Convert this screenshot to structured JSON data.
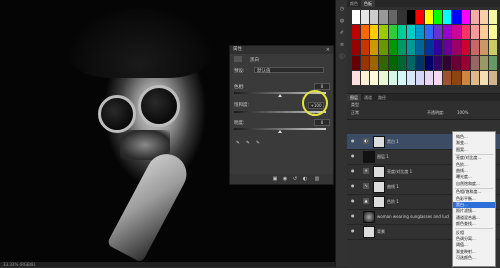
{
  "status": {
    "text": "33.33% (RGB/8)"
  },
  "properties": {
    "title": "属性",
    "adjustment_name": "黑白",
    "preset_label": "预设:",
    "preset_value": "默认值",
    "slider1_label": "色相:",
    "slider1_value": "0",
    "slider2_label": "饱和度:",
    "slider2_value": "+100",
    "slider3_label": "明度:",
    "slider3_value": "0"
  },
  "swatches": {
    "tabs": [
      "颜色",
      "色板"
    ],
    "colors": [
      "#ffffff",
      "#e6e6e6",
      "#cccccc",
      "#999999",
      "#666666",
      "#333333",
      "#000000",
      "#ff0000",
      "#ffff00",
      "#00ff00",
      "#00ffff",
      "#0000ff",
      "#ff00ff",
      "#f5a9a9",
      "#f5d0a9",
      "#f5f5a9",
      "#c00000",
      "#ff6600",
      "#ffcc00",
      "#99cc00",
      "#33cc33",
      "#00cc99",
      "#00cccc",
      "#0099cc",
      "#3366ff",
      "#6633cc",
      "#9900cc",
      "#cc0099",
      "#ff3366",
      "#ff9999",
      "#ffcc99",
      "#ffff99",
      "#990000",
      "#cc3300",
      "#cc9900",
      "#669900",
      "#009900",
      "#009966",
      "#009999",
      "#006699",
      "#003399",
      "#330099",
      "#660099",
      "#990066",
      "#cc0033",
      "#cc6666",
      "#cc9966",
      "#cccc66",
      "#660000",
      "#993300",
      "#996600",
      "#336600",
      "#006600",
      "#006633",
      "#006666",
      "#003366",
      "#000066",
      "#330066",
      "#330033",
      "#660033",
      "#990033",
      "#996666",
      "#999966",
      "#669966",
      "#ffe0e0",
      "#ffefd6",
      "#fffbd6",
      "#e8f7d6",
      "#d6f7e8",
      "#d6f7f7",
      "#d6e8f7",
      "#d6d6f7",
      "#e8d6f7",
      "#f7d6f0",
      "#a0522d",
      "#8b4513",
      "#cd853f",
      "#deb887",
      "#f5deb3",
      "#d2b48c"
    ]
  },
  "layers": {
    "tabs": [
      "图层",
      "通道",
      "路径"
    ],
    "kind_label": "类型",
    "blend_mode": "正常",
    "opacity_label": "不透明度:",
    "opacity_value": "100%",
    "lock_label": "锁定:",
    "fill_label": "填充:",
    "fill_value": "100%",
    "items": [
      {
        "name": "黑白 1"
      },
      {
        "name": "图层 1"
      },
      {
        "name": "亮度/对比度 1"
      },
      {
        "name": "曲线 1"
      },
      {
        "name": "色阶 1"
      },
      {
        "name": "woman wearing sunglasses and lucky skin sheet"
      },
      {
        "name": "背景"
      }
    ]
  },
  "context_menu": {
    "items": [
      "纯色...",
      "渐变...",
      "图案...",
      "亮度/对比度...",
      "色阶...",
      "曲线...",
      "曝光度...",
      "自然饱和度...",
      "色相/饱和度...",
      "色彩平衡...",
      "黑白...",
      "照片滤镜...",
      "通道混合器...",
      "颜色查找...",
      "反相",
      "色调分离...",
      "阈值...",
      "渐变映射...",
      "可选颜色..."
    ],
    "active_index": 10
  }
}
